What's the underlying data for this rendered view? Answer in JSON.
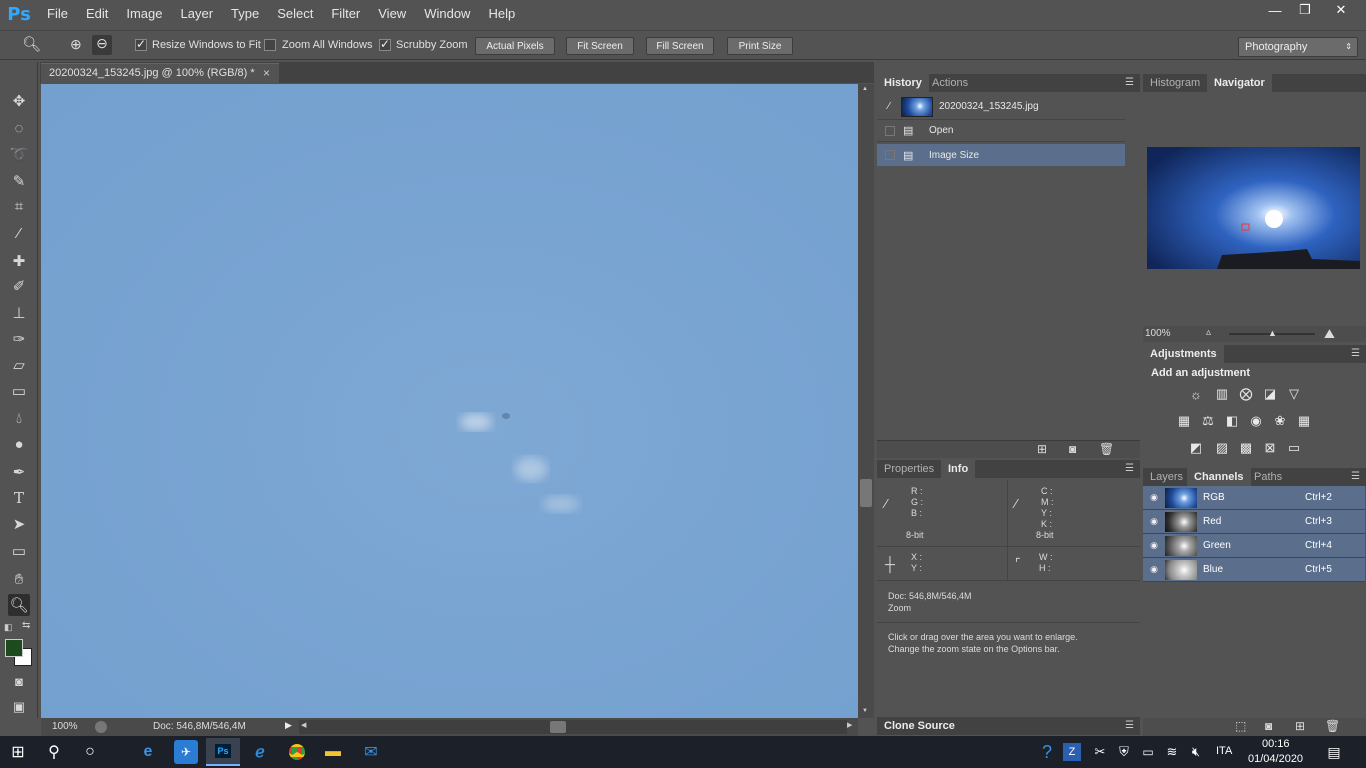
{
  "menu": {
    "logo": "Ps",
    "items": [
      "File",
      "Edit",
      "Image",
      "Layer",
      "Type",
      "Select",
      "Filter",
      "View",
      "Window",
      "Help"
    ]
  },
  "window_controls": [
    "—",
    "❐",
    "✕"
  ],
  "options": {
    "resize_windows": "Resize Windows to Fit",
    "zoom_all": "Zoom All Windows",
    "scrubby_zoom": "Scrubby Zoom",
    "actual_pixels": "Actual Pixels",
    "fit_screen": "Fit Screen",
    "fill_screen": "Fill Screen",
    "print_size": "Print Size",
    "workspace": "Photography"
  },
  "document": {
    "tab_title": "20200324_153245.jpg @ 100% (RGB/8) *",
    "close": "×",
    "zoom": "100%",
    "doc_size": "Doc: 546,8M/546,4M"
  },
  "history_panel": {
    "tabs": [
      "History",
      "Actions"
    ],
    "snapshot": "20200324_153245.jpg",
    "items": [
      "Open",
      "Image Size"
    ]
  },
  "info_panel": {
    "tabs": [
      "Properties",
      "Info"
    ],
    "rgb_labels": [
      "R :",
      "G :",
      "B :"
    ],
    "cmyk_labels": [
      "C :",
      "M :",
      "Y :",
      "K :"
    ],
    "bit_left": "8-bit",
    "bit_right": "8-bit",
    "xy_labels": [
      "X :",
      "Y :"
    ],
    "wh_labels": [
      "W :",
      "H :"
    ],
    "doc": "Doc: 546,8M/546,4M",
    "tool": "Zoom",
    "hint_1": "Click or drag over the area you want to enlarge.",
    "hint_2": "Change the zoom state on the Options bar."
  },
  "clone_source": "Clone Source",
  "navigator": {
    "tabs": [
      "Histogram",
      "Navigator"
    ],
    "zoom": "100%"
  },
  "adjustments": {
    "title": "Adjustments",
    "subtitle": "Add an adjustment"
  },
  "channels_panel": {
    "tabs": [
      "Layers",
      "Channels",
      "Paths"
    ],
    "channels": [
      {
        "name": "RGB",
        "shortcut": "Ctrl+2"
      },
      {
        "name": "Red",
        "shortcut": "Ctrl+3"
      },
      {
        "name": "Green",
        "shortcut": "Ctrl+4"
      },
      {
        "name": "Blue",
        "shortcut": "Ctrl+5"
      }
    ]
  },
  "taskbar": {
    "lang": "ITA",
    "time": "00:16",
    "date": "01/04/2020"
  },
  "colors": {
    "accent_ps": "#31a8ff",
    "selection_row": "#5b6f8c",
    "sky": "#79a4d2"
  }
}
